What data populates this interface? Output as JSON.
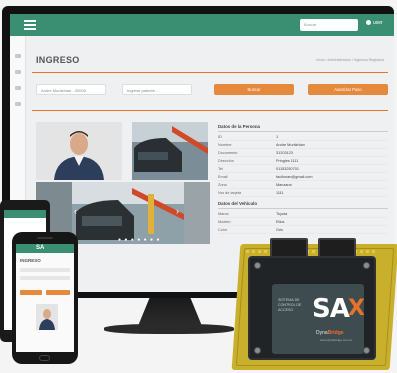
{
  "desktop": {
    "search_placeholder": "Buscar",
    "user_label": "user",
    "page_title": "INGRESO",
    "breadcrumb": "Inicio / Administración / Ingresos Registros",
    "filter_select": "Andre Muritzhian - 00000",
    "filter_input_placeholder": "Ingrese patente...",
    "btn_search": "Buscar",
    "btn_auth": "Autorizar Paso",
    "person_section": "Datos de la Persona",
    "person_rows": [
      {
        "k": "ID",
        "v": "1"
      },
      {
        "k": "Nombre",
        "v": "Andre Muritzhian"
      },
      {
        "k": "Documento",
        "v": "31203123"
      },
      {
        "k": "Dirección",
        "v": "Pringles 1111"
      },
      {
        "k": "Tel",
        "v": "01153250701"
      },
      {
        "k": "Email",
        "v": "facifonan@gmail.com"
      },
      {
        "k": "Zona",
        "v": "Manzana"
      },
      {
        "k": "Nro de tarjeta",
        "v": "1111"
      }
    ],
    "vehicle_section": "Datos del Vehículo",
    "vehicle_rows": [
      {
        "k": "Marca",
        "v": "Toyota"
      },
      {
        "k": "Modelo",
        "v": "Etios"
      },
      {
        "k": "Color",
        "v": "Gris"
      }
    ],
    "carousel_dots": "● ● ● ● ● ● ●"
  },
  "phone": {
    "logo": "SA",
    "title": "INGRESO"
  },
  "device": {
    "label_line1": "SISTEMA DE",
    "label_line2": "CONTROL DE",
    "label_line3": "ACCESO",
    "logo_sa": "SA",
    "logo_x": "X",
    "brand_prefix": "Dyna",
    "brand_suffix": "Bridge",
    "url": "www.dynabridge.com.ar"
  },
  "colors": {
    "header_green": "#3a8f73",
    "accent_orange": "#e8722c",
    "board_yellow": "#c9b02c"
  }
}
